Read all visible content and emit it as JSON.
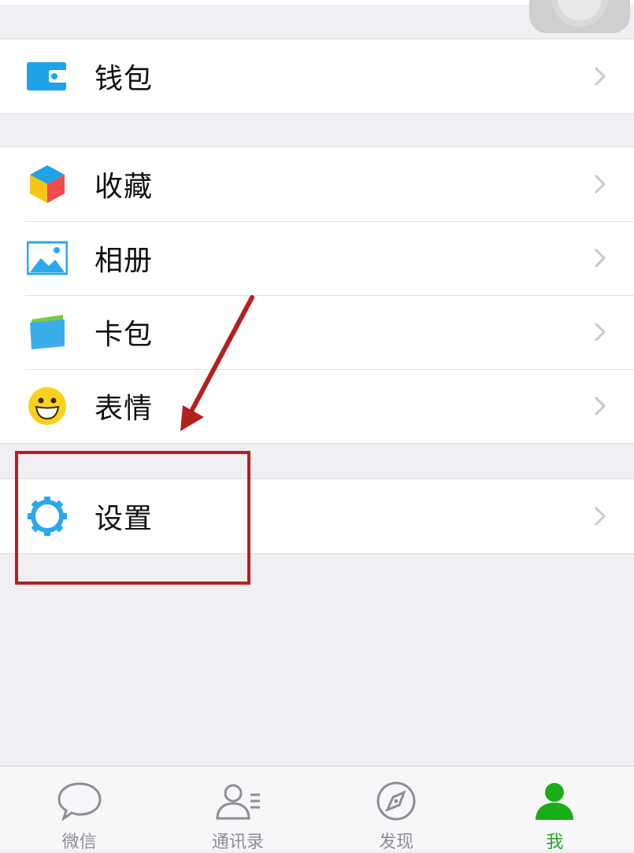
{
  "menu_groups": [
    {
      "items": [
        {
          "label": "钱包",
          "icon": "wallet-icon"
        }
      ]
    },
    {
      "items": [
        {
          "label": "收藏",
          "icon": "favorites-cube-icon"
        },
        {
          "label": "相册",
          "icon": "album-photo-icon"
        },
        {
          "label": "卡包",
          "icon": "card-wallet-icon"
        },
        {
          "label": "表情",
          "icon": "smiley-face-icon"
        }
      ]
    },
    {
      "items": [
        {
          "label": "设置",
          "icon": "settings-gear-icon"
        }
      ]
    }
  ],
  "tabbar": {
    "tabs": [
      {
        "label": "微信",
        "icon": "chat-bubble-icon",
        "active": false
      },
      {
        "label": "通讯录",
        "icon": "contacts-icon",
        "active": false
      },
      {
        "label": "发现",
        "icon": "compass-icon",
        "active": false
      },
      {
        "label": "我",
        "icon": "person-icon",
        "active": true
      }
    ]
  },
  "colors": {
    "background": "#efeff4",
    "row_background": "#ffffff",
    "icon_blue": "#1ea3e8",
    "active_tab": "#1aad19",
    "inactive_tab": "#8e8e93",
    "annotation_red": "#b3201f"
  }
}
